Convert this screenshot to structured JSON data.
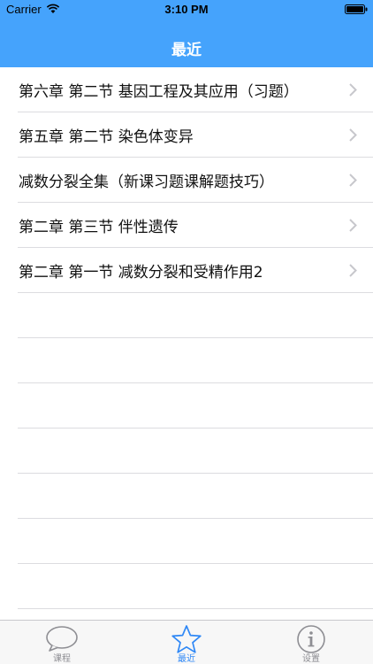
{
  "status": {
    "carrier": "Carrier",
    "time": "3:10 PM"
  },
  "nav": {
    "title": "最近"
  },
  "list": {
    "items": [
      {
        "label": "第六章 第二节 基因工程及其应用（习题）"
      },
      {
        "label": "第五章 第二节 染色体变异"
      },
      {
        "label": "减数分裂全集（新课习题课解题技巧）"
      },
      {
        "label": "第二章 第三节 伴性遗传"
      },
      {
        "label": "第二章 第一节 减数分裂和受精作用2"
      }
    ]
  },
  "tabs": [
    {
      "label": "课程",
      "icon": "chat-bubble-icon",
      "active": false
    },
    {
      "label": "最近",
      "icon": "star-icon",
      "active": true
    },
    {
      "label": "设置",
      "icon": "info-icon",
      "active": false
    }
  ],
  "colors": {
    "accent": "#45a3fc",
    "tab_active": "#2f88f6",
    "tab_inactive": "#8e8e93"
  }
}
